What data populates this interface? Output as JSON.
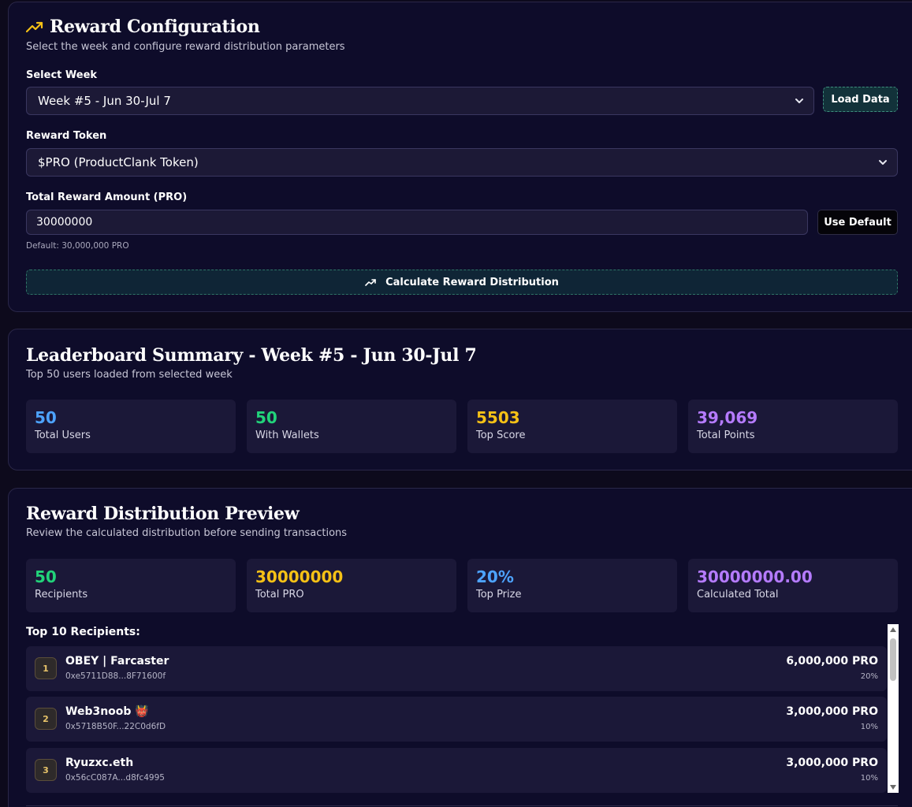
{
  "config": {
    "title": "Reward Configuration",
    "subtitle": "Select the week and configure reward distribution parameters",
    "week_label": "Select Week",
    "week_value": "Week #5 - Jun 30-Jul 7",
    "load_button": "Load Data",
    "token_label": "Reward Token",
    "token_value": "$PRO (ProductClank Token)",
    "amount_label": "Total Reward Amount (PRO)",
    "amount_value": "30000000",
    "default_button": "Use Default",
    "default_hint": "Default: 30,000,000 PRO",
    "calc_button": "Calculate Reward Distribution"
  },
  "leaderboard": {
    "title": "Leaderboard Summary - Week #5 - Jun 30-Jul 7",
    "subtitle": "Top 50 users loaded from selected week",
    "stats": [
      {
        "value": "50",
        "label": "Total Users",
        "color": "#4da3ff"
      },
      {
        "value": "50",
        "label": "With Wallets",
        "color": "#22d37a"
      },
      {
        "value": "5503",
        "label": "Top Score",
        "color": "#f5c116"
      },
      {
        "value": "39,069",
        "label": "Total Points",
        "color": "#b57bff"
      }
    ]
  },
  "distribution": {
    "title": "Reward Distribution Preview",
    "subtitle": "Review the calculated distribution before sending transactions",
    "stats": [
      {
        "value": "50",
        "label": "Recipients",
        "color": "#22d37a"
      },
      {
        "value": "30000000",
        "label": "Total PRO",
        "color": "#f5c116"
      },
      {
        "value": "20%",
        "label": "Top Prize",
        "color": "#4da3ff"
      },
      {
        "value": "30000000.00",
        "label": "Calculated Total",
        "color": "#b57bff"
      }
    ],
    "recipients_title": "Top 10 Recipients:",
    "recipients": [
      {
        "rank": "1",
        "name": "OBEY | Farcaster",
        "address": "0xe5711D88...8F71600f",
        "amount": "6,000,000 PRO",
        "percent": "20%"
      },
      {
        "rank": "2",
        "name": "Web3noob 👹",
        "address": "0x5718B50F...22C0d6fD",
        "amount": "3,000,000 PRO",
        "percent": "10%"
      },
      {
        "rank": "3",
        "name": "Ryuzxc.eth",
        "address": "0x56cC087A...d8fc4995",
        "amount": "3,000,000 PRO",
        "percent": "10%"
      }
    ]
  },
  "colors": {
    "accent_icon": "#f5c116",
    "background": "#0d0a1c",
    "card": "#0e0c2a"
  }
}
